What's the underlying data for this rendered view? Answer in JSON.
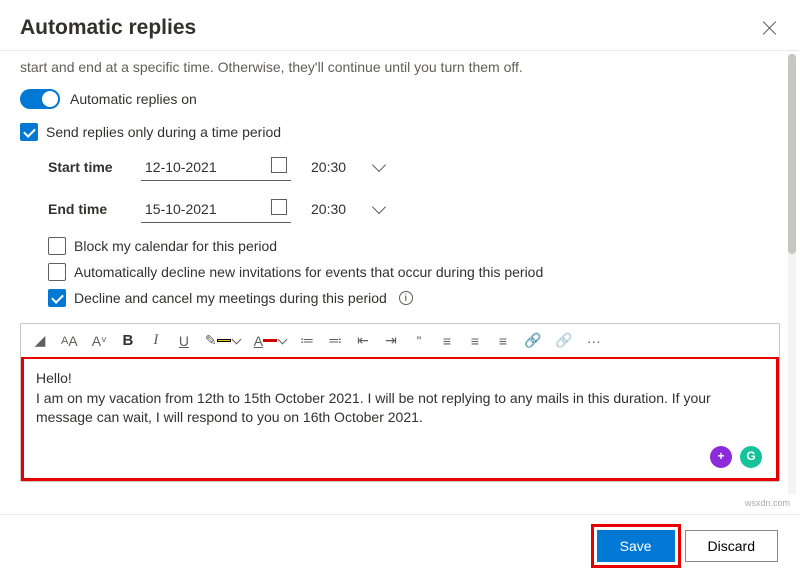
{
  "header": {
    "title": "Automatic replies"
  },
  "desc": "start and end at a specific time. Otherwise, they'll continue until you turn them off.",
  "toggle": {
    "label": "Automatic replies on"
  },
  "period": {
    "label": "Send replies only during a time period",
    "start_label": "Start time",
    "start_date": "12-10-2021",
    "start_time": "20:30",
    "end_label": "End time",
    "end_date": "15-10-2021",
    "end_time": "20:30"
  },
  "options": {
    "block": "Block my calendar for this period",
    "decline_new": "Automatically decline new invitations for events that occur during this period",
    "cancel": "Decline and cancel my meetings during this period"
  },
  "message": {
    "line1": "Hello!",
    "line2": "I am on my vacation from 12th to 15th October 2021. I will be not replying to any mails in this duration. If your message can wait, I will respond to you on 16th October 2021."
  },
  "buttons": {
    "save": "Save",
    "discard": "Discard"
  },
  "tb": {
    "bold": "B",
    "italic": "I",
    "underline": "U",
    "quote": "”",
    "more": "···",
    "fontA": "A",
    "link": "🔗",
    "bullets": "≡",
    "num": "≣",
    "out": "⇤",
    "in": "⇥",
    "al": "≡",
    "ac": "≡",
    "ar": "≡",
    "eraser": "◢",
    "G": "G",
    "plus": "+"
  },
  "watermark": "wsxdn.com"
}
